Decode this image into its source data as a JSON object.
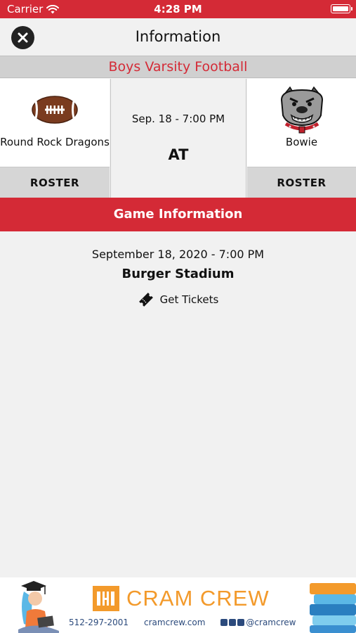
{
  "status_bar": {
    "carrier": "Carrier",
    "time": "4:28 PM"
  },
  "nav": {
    "title": "Information"
  },
  "sport": {
    "title": "Boys Varsity Football"
  },
  "match": {
    "home": {
      "name": "Round Rock Dragons",
      "roster_label": "ROSTER",
      "logo_icon": "football-icon"
    },
    "away": {
      "name": "Bowie",
      "roster_label": "ROSTER",
      "logo_icon": "bulldog-logo"
    },
    "date": "Sep. 18 - 7:00 PM",
    "separator": "AT"
  },
  "game_info": {
    "header": "Game Information",
    "datetime": "September 18, 2020 - 7:00 PM",
    "venue": "Burger Stadium",
    "tickets_label": "Get Tickets"
  },
  "ad": {
    "brand": "CRAM CREW",
    "phone": "512-297-2001",
    "website": "cramcrew.com",
    "social": "@cramcrew"
  },
  "colors": {
    "accent": "#d42a36",
    "ad_orange": "#f39a2b",
    "ad_blue": "#2b4a7c"
  }
}
